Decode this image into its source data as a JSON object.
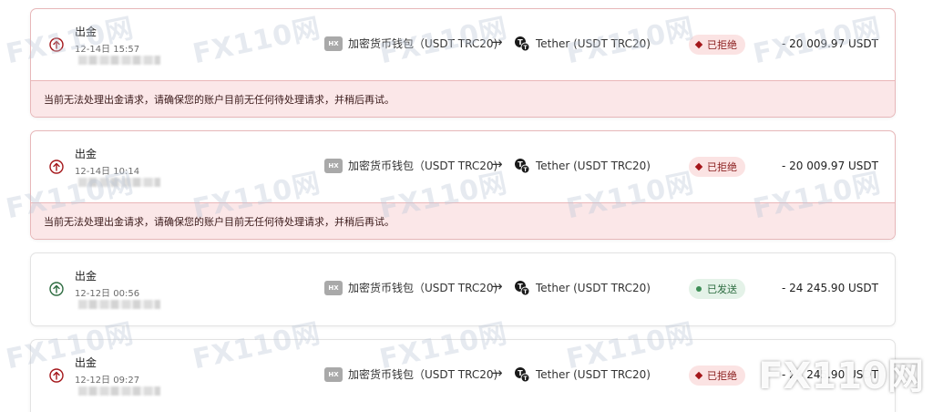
{
  "transactions": [
    {
      "title": "出金",
      "date": "12-14日 15:57",
      "from": "加密货币钱包（USDT TRC20)",
      "from_badge": "HX",
      "to": "Tether (USDT TRC20)",
      "status": "已拒绝",
      "status_type": "rejected",
      "amount": "- 20 009.97 USDT",
      "error": "当前无法处理出金请求，请确保您的账户目前无任何待处理请求，并稍后再试。"
    },
    {
      "title": "出金",
      "date": "12-14日 10:14",
      "from": "加密货币钱包（USDT TRC20)",
      "from_badge": "HX",
      "to": "Tether (USDT TRC20)",
      "status": "已拒绝",
      "status_type": "rejected",
      "amount": "- 20 009.97 USDT",
      "error": "当前无法处理出金请求，请确保您的账户目前无任何待处理请求，并稍后再试。"
    },
    {
      "title": "出金",
      "date": "12-12日 00:56",
      "from": "加密货币钱包（USDT TRC20)",
      "from_badge": "HX",
      "to": "Tether (USDT TRC20)",
      "status": "已发送",
      "status_type": "sent",
      "amount": "- 24 245.90 USDT",
      "error": ""
    },
    {
      "title": "出金",
      "date": "12-12日 09:27",
      "from": "加密货币钱包（USDT TRC20)",
      "from_badge": "HX",
      "to": "Tether (USDT TRC20)",
      "status": "已拒绝",
      "status_type": "rejected",
      "amount": "- 24 245.90 USDT",
      "error": ""
    }
  ],
  "arrow_symbol": "→",
  "watermark": "FX110网",
  "colors": {
    "rejected_bg": "#fbe3e3",
    "rejected_text": "#8a1d1d",
    "sent_bg": "#e4f2e8",
    "sent_text": "#2c6b3f",
    "error_bg": "#fbe7e8",
    "icon_rejected": "#a4161a",
    "icon_sent": "#2c6b3f"
  }
}
